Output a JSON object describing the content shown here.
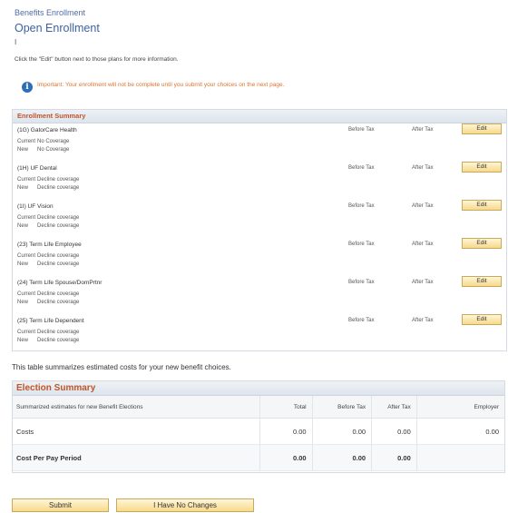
{
  "breadcrumb": "Benefits Enrollment",
  "page_title": "Open Enrollment",
  "name_line": "I",
  "instruction": "Click the \"Edit\" button next to those plans for more information.",
  "important": "Important: Your enrollment will not be complete until you submit your choices on the next page.",
  "info_icon_char": "i",
  "enrollment_summary": {
    "title": "Enrollment Summary",
    "before_tax": "Before Tax",
    "after_tax": "After Tax",
    "edit_label": "Edit",
    "current_label": "Current",
    "new_label": "New",
    "plans": [
      {
        "name": "(1G) GatorCare Health",
        "current": "No Coverage",
        "new": "No Coverage"
      },
      {
        "name": "(1H) UF Dental",
        "current": "Decline coverage",
        "new": "Decline coverage"
      },
      {
        "name": "(1I) UF Vision",
        "current": "Decline coverage",
        "new": "Decline coverage"
      },
      {
        "name": "(23) Term Life Employee",
        "current": "Decline coverage",
        "new": "Decline coverage"
      },
      {
        "name": "(24) Term Life Spouse/DomPrtnr",
        "current": "Decline coverage",
        "new": "Decline coverage"
      },
      {
        "name": "(25) Term Life Dependent",
        "current": "Decline coverage",
        "new": "Decline coverage"
      }
    ]
  },
  "summary_description": "This table summarizes estimated costs for your new benefit choices.",
  "election_summary": {
    "title": "Election Summary",
    "columns": [
      "Summarized estimates for new Benefit Elections",
      "Total",
      "Before Tax",
      "After Tax",
      "Employer"
    ],
    "rows": [
      {
        "label": "Costs",
        "total": "0.00",
        "before_tax": "0.00",
        "after_tax": "0.00",
        "employer": "0.00"
      },
      {
        "label": "Cost Per Pay Period",
        "total": "0.00",
        "before_tax": "0.00",
        "after_tax": "0.00",
        "employer": ""
      }
    ]
  },
  "buttons": {
    "submit": "Submit",
    "no_changes": "I Have No Changes"
  },
  "colors": {
    "accent_orange": "#c0552a",
    "link_blue": "#3d62a3",
    "button_gold": "#f7d98a"
  }
}
